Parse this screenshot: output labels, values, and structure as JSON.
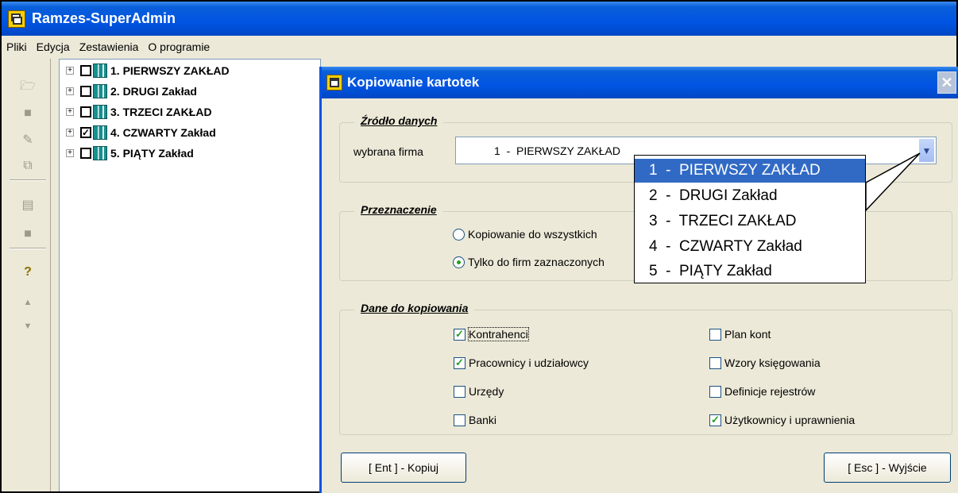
{
  "app": {
    "title": "Ramzes-SuperAdmin"
  },
  "menu": [
    "Pliki",
    "Edycja",
    "Zestawienia",
    "O programie"
  ],
  "toolbar_icons": [
    "open-folder-icon",
    "save-icon",
    "edit-pencil-icon",
    "copy-icon",
    "document-icon",
    "stop-icon",
    "help-key-icon",
    "arrow-up-icon",
    "arrow-down-icon"
  ],
  "tree": {
    "items": [
      {
        "expander": "+",
        "checked": false,
        "check": "",
        "label": "1. PIERWSZY ZAKŁAD"
      },
      {
        "expander": "+",
        "checked": false,
        "check": "",
        "label": "2. DRUGI Zakład"
      },
      {
        "expander": "+",
        "checked": false,
        "check": "",
        "label": "3. TRZECI ZAKŁAD"
      },
      {
        "expander": "+",
        "checked": true,
        "check": "✓",
        "label": "4. CZWARTY Zakład"
      },
      {
        "expander": "+",
        "checked": false,
        "check": "",
        "label": "5. PIĄTY Zakład"
      }
    ]
  },
  "dialog": {
    "title": "Kopiowanie kartotek",
    "close_glyph": "✕",
    "source": {
      "group_title": "Źródło danych",
      "label": "wybrana firma",
      "value": "1  -  PIERWSZY ZAKŁAD"
    },
    "target": {
      "group_title": "Przeznaczenie",
      "options": [
        {
          "label": "Kopiowanie do wszystkich",
          "selected": false
        },
        {
          "label": "Tylko do firm zaznaczonych",
          "selected": true
        }
      ]
    },
    "data": {
      "group_title": "Dane do kopiowania",
      "left": [
        {
          "label": "Kontrahenci",
          "checked": true,
          "check": "✓"
        },
        {
          "label": "Pracownicy i udziałowcy",
          "checked": true,
          "check": "✓"
        },
        {
          "label": "Urzędy",
          "checked": false,
          "check": ""
        },
        {
          "label": "Banki",
          "checked": false,
          "check": ""
        }
      ],
      "right": [
        {
          "label": "Plan kont",
          "checked": false,
          "check": ""
        },
        {
          "label": "Wzory księgowania",
          "checked": false,
          "check": ""
        },
        {
          "label": "Definicje rejestrów",
          "checked": false,
          "check": ""
        },
        {
          "label": "Użytkownicy i uprawnienia",
          "checked": true,
          "check": "✓"
        }
      ]
    },
    "buttons": {
      "copy": "[ Ent ] - Kopiuj",
      "exit": "[ Esc ] - Wyjście"
    }
  },
  "dropdown": {
    "items": [
      {
        "label": "1  -  PIERWSZY ZAKŁAD",
        "selected": true
      },
      {
        "label": "2  -  DRUGI Zakład",
        "selected": false
      },
      {
        "label": "3  -  TRZECI ZAKŁAD",
        "selected": false
      },
      {
        "label": "4  -  CZWARTY Zakład",
        "selected": false
      },
      {
        "label": "5  -  PIĄTY Zakład",
        "selected": false
      }
    ]
  }
}
